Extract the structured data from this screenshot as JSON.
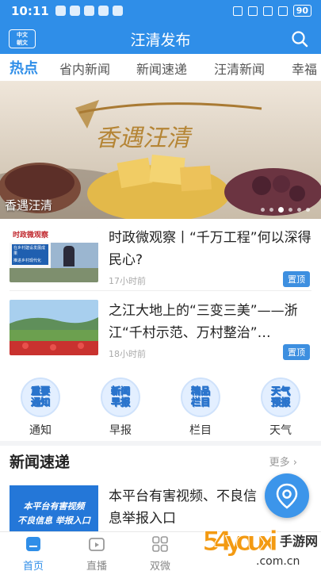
{
  "status_bar": {
    "time": "10:11",
    "battery": "90"
  },
  "header": {
    "logo_line1": "中文",
    "logo_line2": "朝文",
    "title": "汪清发布"
  },
  "tabs": [
    {
      "label": "热点",
      "active": true
    },
    {
      "label": "省内新闻"
    },
    {
      "label": "新闻速递"
    },
    {
      "label": "汪清新闻"
    },
    {
      "label": "幸福"
    }
  ],
  "banner": {
    "caption": "香遇汪清",
    "art_text": "香遇汪清",
    "dot_count": 6,
    "active_dot": 3
  },
  "news": [
    {
      "title": "时政微观察丨“千万工程”何以深得民心?",
      "time": "17小时前",
      "badge": "置顶",
      "thumb_text_1": "时政微观察",
      "thumb_text_2": "在乡村建设发展成果",
      "thumb_text_3": "推进乡村现代化"
    },
    {
      "title": "之江大地上的“三变三美”——浙江“千村示范、万村整治”…",
      "time": "18小时前",
      "badge": "置顶"
    }
  ],
  "quick_links": [
    {
      "icon_text_1": "重要",
      "icon_text_2": "通知",
      "label": "通知"
    },
    {
      "icon_text_1": "新闻",
      "icon_text_2": "早报",
      "label": "早报"
    },
    {
      "icon_text_1": "精品",
      "icon_text_2": "栏目",
      "label": "栏目"
    },
    {
      "icon_text_1": "天气",
      "icon_text_2": "预报",
      "label": "天气"
    }
  ],
  "section": {
    "title": "新闻速递",
    "more": "更多"
  },
  "news3": {
    "title": "本平台有害视频、不良信息举报入口",
    "thumb_text_1": "本平台有害视频",
    "thumb_text_2": "不良信息 举报入口"
  },
  "bottom_nav": [
    {
      "label": "首页",
      "icon": "home-icon",
      "active": true
    },
    {
      "label": "直播",
      "icon": "live-icon"
    },
    {
      "label": "双微",
      "icon": "grid-icon"
    }
  ],
  "watermark": {
    "text": "54youxi",
    "sub": "手游网",
    "domain": ".com.cn"
  },
  "colors": {
    "brand": "#2f8ee8",
    "badge": "#3d8fe0"
  }
}
